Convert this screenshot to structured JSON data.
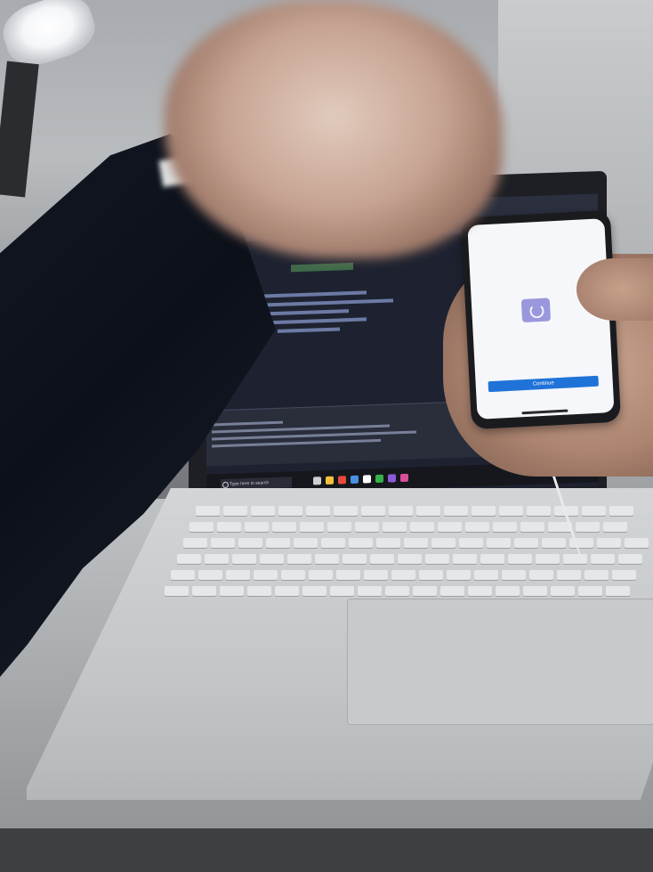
{
  "scene": {
    "description_objects": [
      "desk-lamp",
      "laptop",
      "smartphone",
      "raised-arm",
      "hand-holding-phone",
      "usb-cable"
    ]
  },
  "laptop_screen": {
    "taskbar_search_placeholder": "Type here to search"
  },
  "phone": {
    "continue_label": "Continue"
  },
  "colors": {
    "ide_background": "#1e2230",
    "phone_button": "#1f73d8",
    "phone_spinner_box": "#9a97dc"
  }
}
